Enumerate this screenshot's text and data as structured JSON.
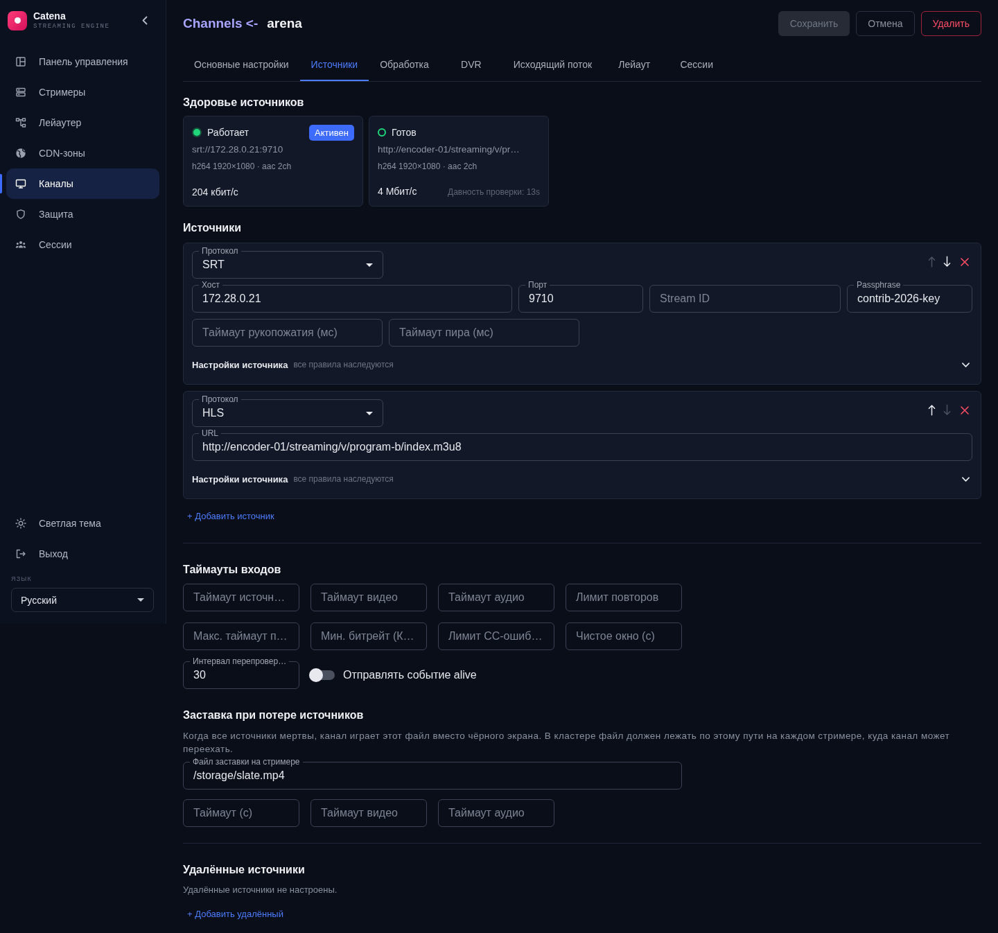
{
  "sidebar": {
    "brand": {
      "name": "Catena",
      "tagline": "STREAMING ENGINE"
    },
    "nav": [
      {
        "label": "Панель управления",
        "selected": false
      },
      {
        "label": "Стримеры",
        "selected": false
      },
      {
        "label": "Лейаутер",
        "selected": false
      },
      {
        "label": "CDN-зоны",
        "selected": false
      },
      {
        "label": "Каналы",
        "selected": true
      },
      {
        "label": "Защита",
        "selected": false
      },
      {
        "label": "Сессии",
        "selected": false
      }
    ],
    "footer": [
      {
        "label": "Светлая тема"
      },
      {
        "label": "Выход"
      }
    ],
    "language": {
      "label": "ЯЗЫК",
      "value": "Русский"
    }
  },
  "header": {
    "breadcrumb": "Channels <-",
    "title": "arena",
    "buttons": [
      {
        "label": "Сохранить",
        "kind": "primary",
        "disabled": true
      },
      {
        "label": "Отмена",
        "kind": "ghost",
        "disabled": false
      },
      {
        "label": "Удалить",
        "kind": "danger",
        "disabled": false
      }
    ]
  },
  "tabs": [
    {
      "label": "Основные настройки",
      "selected": false
    },
    {
      "label": "Источники",
      "selected": true
    },
    {
      "label": "Обработка",
      "selected": false
    },
    {
      "label": "DVR",
      "selected": false
    },
    {
      "label": "Исходящий поток",
      "selected": false
    },
    {
      "label": "Лейаут",
      "selected": false
    },
    {
      "label": "Сессии",
      "selected": false
    }
  ],
  "health": {
    "title": "Здоровье источников",
    "cards": [
      {
        "kind": "running",
        "status": "Работает",
        "badge": "Активен",
        "url": "srt://172.28.0.21:9710",
        "codec": "h264 1920×1080 · aac 2ch",
        "bitrate": "204 кбит/с"
      },
      {
        "kind": "ready",
        "status": "Готов",
        "url": "http://encoder-01/streaming/v/pr…",
        "codec": "h264 1920×1080 · aac 2ch",
        "bitrate": "4 Мбит/с",
        "checked": "Давность проверки: 13s"
      }
    ]
  },
  "sources": {
    "title": "Источники",
    "items": [
      {
        "protocol": {
          "label": "Протокол",
          "value": "SRT"
        },
        "up_disabled": true,
        "down_disabled": false,
        "rows": [
          [
            {
              "label": "Хост",
              "value": "172.28.0.21"
            },
            {
              "label": "Порт",
              "value": "9710"
            },
            {
              "placeholder": "Stream ID"
            },
            {
              "label": "Passphrase",
              "value": "contrib-2026-key"
            }
          ],
          [
            {
              "placeholder": "Таймаут рукопожатия (мс)"
            },
            {
              "placeholder": "Таймаут пира (мс)"
            }
          ]
        ],
        "settings": {
          "title": "Настройки источника",
          "note": "все правила наследуются",
          "expanded": false
        }
      },
      {
        "protocol": {
          "label": "Протокол",
          "value": "HLS"
        },
        "up_disabled": false,
        "down_disabled": true,
        "rows": [
          [
            {
              "label": "URL",
              "value": "http://encoder-01/streaming/v/program-b/index.m3u8"
            }
          ]
        ],
        "settings": {
          "title": "Настройки источника",
          "note": "все правила наследуются",
          "expanded": false
        }
      }
    ],
    "add_link": "+ Добавить источник"
  },
  "timeouts": {
    "title": "Таймауты входов",
    "fields": [
      {
        "placeholder": "Таймаут источн…"
      },
      {
        "placeholder": "Таймаут видео"
      },
      {
        "placeholder": "Таймаут аудио"
      },
      {
        "placeholder": "Лимит повторов"
      },
      {
        "placeholder": "Макс. таймаут п…"
      },
      {
        "placeholder": "Мин. битрейт (К…"
      },
      {
        "placeholder": "Лимит CC-ошиб…"
      },
      {
        "placeholder": "Чистое окно (с)"
      }
    ],
    "interval": {
      "label": "Интервал перепровер…",
      "value": "30"
    },
    "toggle": {
      "label": "Отправлять событие alive",
      "on": false
    }
  },
  "slate": {
    "title": "Заставка при потере источников",
    "description": "Когда все источники мертвы, канал играет этот файл вместо чёрного экрана. В кластере файл должен лежать по этому пути на каждом стримере, куда канал может переехать.",
    "file": {
      "label": "Файл заставки на стримере",
      "value": "/storage/slate.mp4"
    },
    "fields": [
      {
        "placeholder": "Таймаут (с)"
      },
      {
        "placeholder": "Таймаут видео"
      },
      {
        "placeholder": "Таймаут аудио"
      }
    ]
  },
  "remote": {
    "title": "Удалённые источники",
    "empty_text": "Удалённые источники не настроены.",
    "add_link": "+ Добавить удалённый"
  }
}
